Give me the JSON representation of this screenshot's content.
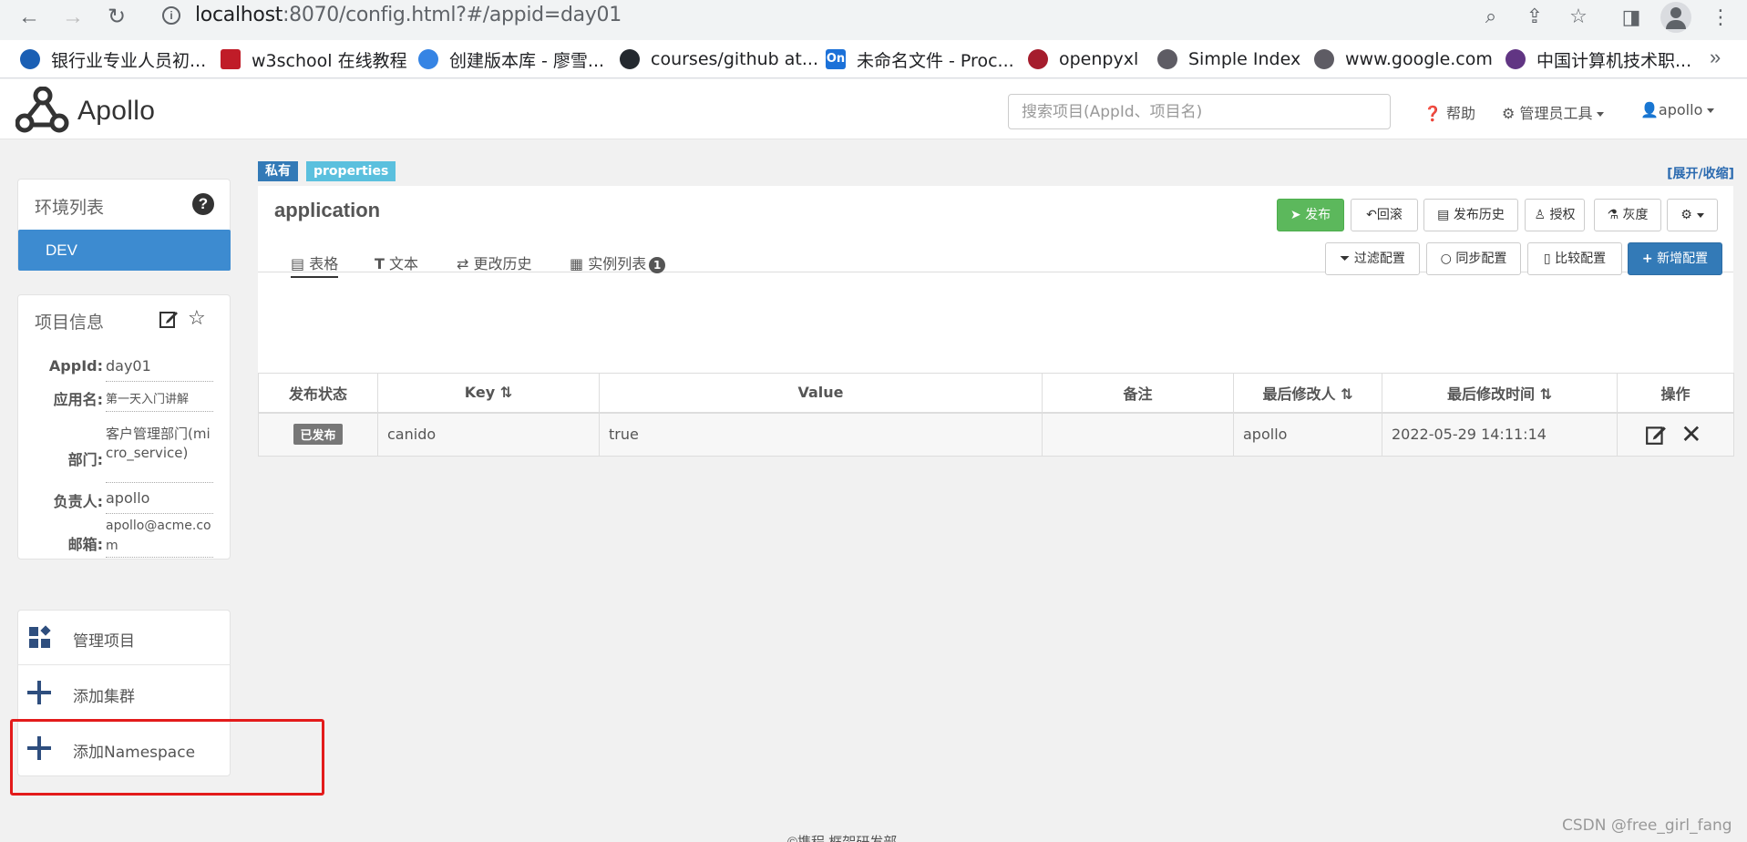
{
  "browser": {
    "url_host": "localhost",
    "url_rest": ":8070/config.html?#/appid=day01",
    "bookmarks": [
      {
        "label": "银行业专业人员初...",
        "color": "#1a5fb4"
      },
      {
        "label": "w3school 在线教程",
        "color": "#c01c28"
      },
      {
        "label": "创建版本库 - 廖雪...",
        "color": "#3584e4"
      },
      {
        "label": "courses/github at...",
        "color": "#24292f"
      },
      {
        "label": "未命名文件 - Proc...",
        "color": "#1c71d8"
      },
      {
        "label": "openpyxl",
        "color": "#a51d2d"
      },
      {
        "label": "Simple Index",
        "color": "#5e5c64"
      },
      {
        "label": "www.google.com",
        "color": "#5e5c64"
      },
      {
        "label": "中国计算机技术职...",
        "color": "#613583"
      }
    ],
    "more": "»"
  },
  "header": {
    "logo_text": "Apollo",
    "search_placeholder": "搜索项目(AppId、项目名)",
    "help": "帮助",
    "admin_tools": "管理员工具",
    "user": "apollo"
  },
  "env_panel": {
    "title": "环境列表",
    "env": "DEV"
  },
  "info_panel": {
    "title": "项目信息",
    "rows": [
      {
        "label": "AppId:",
        "value": "day01"
      },
      {
        "label": "应用名:",
        "value": "第一天入门讲解"
      },
      {
        "label": "部门:",
        "value": "客户管理部门(micro_service)"
      },
      {
        "label": "负责人:",
        "value": "apollo"
      },
      {
        "label": "邮箱:",
        "value": "apollo@acme.com"
      }
    ]
  },
  "menu": {
    "manage": "管理项目",
    "add_cluster": "添加集群",
    "add_namespace": "添加Namespace"
  },
  "namespace": {
    "tag_private": "私有",
    "tag_format": "properties",
    "expand": "[展开/收缩]",
    "title": "application",
    "buttons": {
      "publish": "发布",
      "rollback": "回滚",
      "history": "发布历史",
      "grant": "授权",
      "gray": "灰度"
    },
    "tabs": {
      "table": "表格",
      "text": "文本",
      "change_history": "更改历史",
      "instances": "实例列表",
      "instances_count": "1"
    },
    "actions": {
      "filter": "过滤配置",
      "sync": "同步配置",
      "compare": "比较配置",
      "add": "新增配置"
    },
    "columns": {
      "status": "发布状态",
      "key": "Key",
      "value": "Value",
      "comment": "备注",
      "modifier": "最后修改人",
      "modified_time": "最后修改时间",
      "ops": "操作"
    },
    "rows": [
      {
        "status": "已发布",
        "key": "canido",
        "value": "true",
        "comment": "",
        "modifier": "apollo",
        "time": "2022-05-29 14:11:14"
      }
    ]
  },
  "footer": "©携程 框架研发部",
  "watermark": "CSDN @free_girl_fang"
}
